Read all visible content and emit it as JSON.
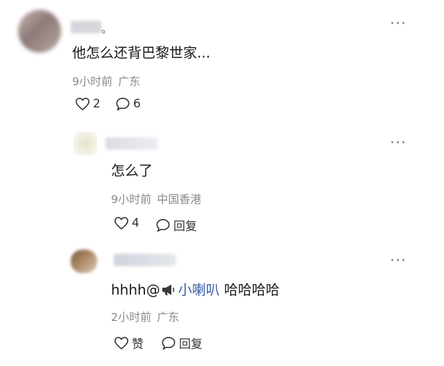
{
  "comments": [
    {
      "name_suffix": "。",
      "text": "他怎么还背巴黎世家...",
      "time": "9小时前",
      "location": "广东",
      "like_count": "2",
      "reply_count": "6"
    },
    {
      "text": "怎么了",
      "time": "9小时前",
      "location": "中国香港",
      "like_count": "4",
      "reply_label": "回复"
    },
    {
      "text_prefix": "hhhh@",
      "mention_name": "小喇叭",
      "text_suffix": " 哈哈哈哈",
      "time": "2小时前",
      "location": "广东",
      "like_label": "赞",
      "reply_label": "回复"
    }
  ],
  "icons": {
    "like": "heart-outline-icon",
    "comment": "speech-bubble-icon",
    "more": "more-dots-icon",
    "mention": "megaphone-icon"
  },
  "colors": {
    "mention": "#3b5fa8",
    "meta": "#8a8a8a"
  }
}
